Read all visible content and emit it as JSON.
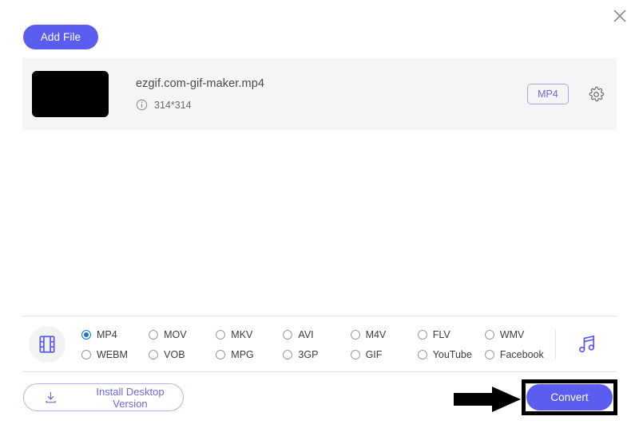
{
  "window": {
    "close_icon": "close-icon"
  },
  "toolbar": {
    "add_file_label": "Add File"
  },
  "file_list": {
    "items": [
      {
        "thumbnail": "video-thumbnail",
        "name": "ezgif.com-gif-maker.mp4",
        "info_icon": "info-icon",
        "resolution": "314*314",
        "format_badge": "MP4",
        "settings_icon": "gear-icon"
      }
    ]
  },
  "format_bar": {
    "video_icon": "film-strip-icon",
    "audio_icon": "music-note-icon",
    "selected": "MP4",
    "options": [
      "MP4",
      "MOV",
      "MKV",
      "AVI",
      "M4V",
      "FLV",
      "WMV",
      "WEBM",
      "VOB",
      "MPG",
      "3GP",
      "GIF",
      "YouTube",
      "Facebook"
    ]
  },
  "footer": {
    "install_icon": "download-icon",
    "install_label": "Install Desktop Version",
    "convert_label": "Convert",
    "annotation_arrow": "arrow-right-annotation"
  },
  "colors": {
    "accent": "#5b5cf0",
    "accent_light": "#6b6be0",
    "radio_selected": "#1a6fd4",
    "row_bg": "#f5f5f5",
    "annotation": "#000000"
  }
}
